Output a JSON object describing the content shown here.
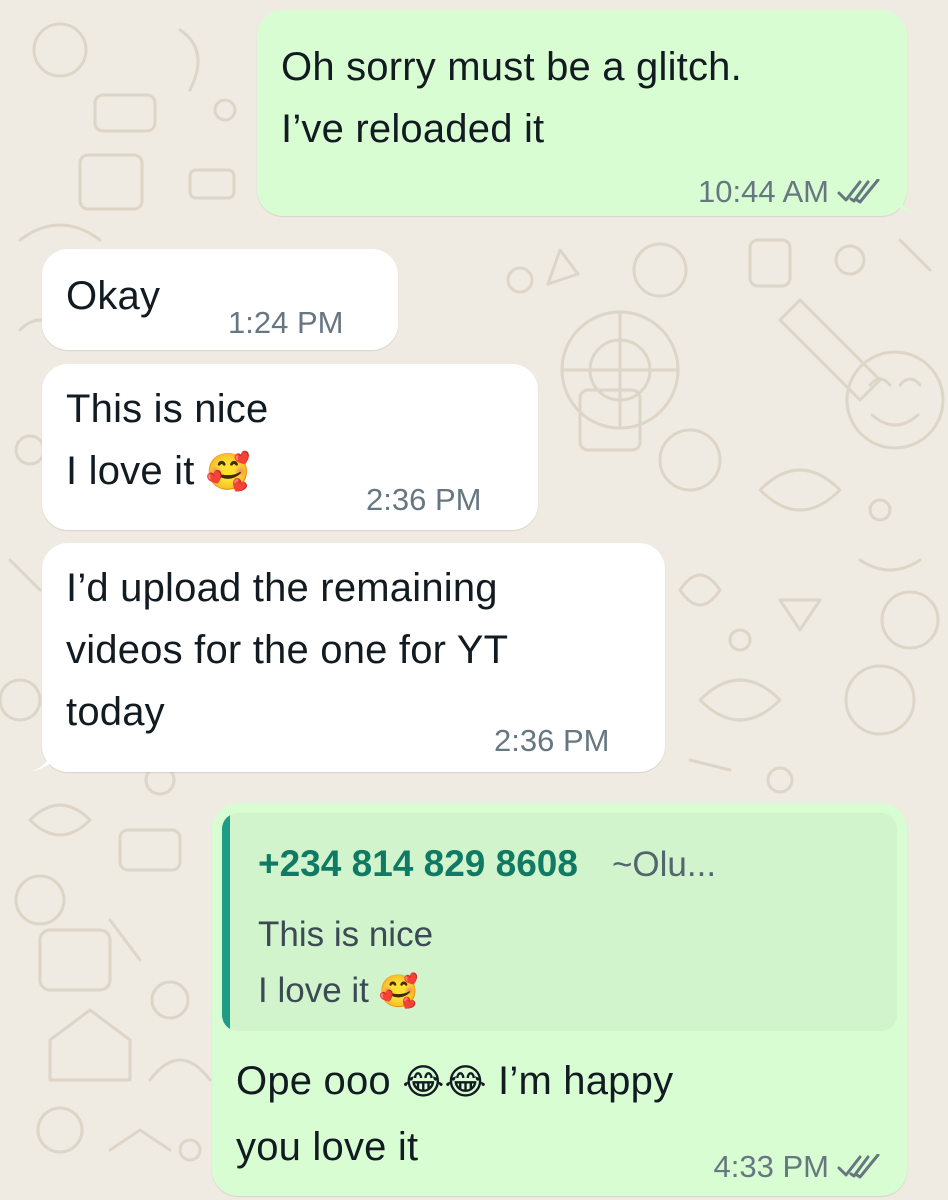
{
  "colors": {
    "chat_background": "#efeae2",
    "outgoing_bubble": "#d9fdd3",
    "incoming_bubble": "#ffffff",
    "quote_accent": "#1f9c85",
    "meta_text": "#667781"
  },
  "icons": {
    "read_receipt": "double-check-icon"
  },
  "messages": [
    {
      "direction": "outgoing",
      "text": "Oh sorry must be a glitch.\nI’ve reloaded it",
      "time": "10:44 AM"
    },
    {
      "direction": "incoming",
      "text": "Okay",
      "time": "1:24 PM"
    },
    {
      "direction": "incoming",
      "text": "This is nice\nI love it",
      "emoji": "🥰",
      "time": "2:36 PM"
    },
    {
      "direction": "incoming",
      "text": "I’d upload the remaining\nvideos for the one for YT\ntoday",
      "time": "2:36 PM"
    }
  ],
  "reply": {
    "quoted": {
      "sender": "+234 814 829 8608",
      "push_name": "~Olu...",
      "text": "This is nice\nI love it",
      "emoji": "🥰"
    },
    "text_part1": "Ope ooo",
    "emojis": "😂😂",
    "text_part2": "I’m happy",
    "text_line2": "you love it",
    "time": "4:33 PM"
  }
}
